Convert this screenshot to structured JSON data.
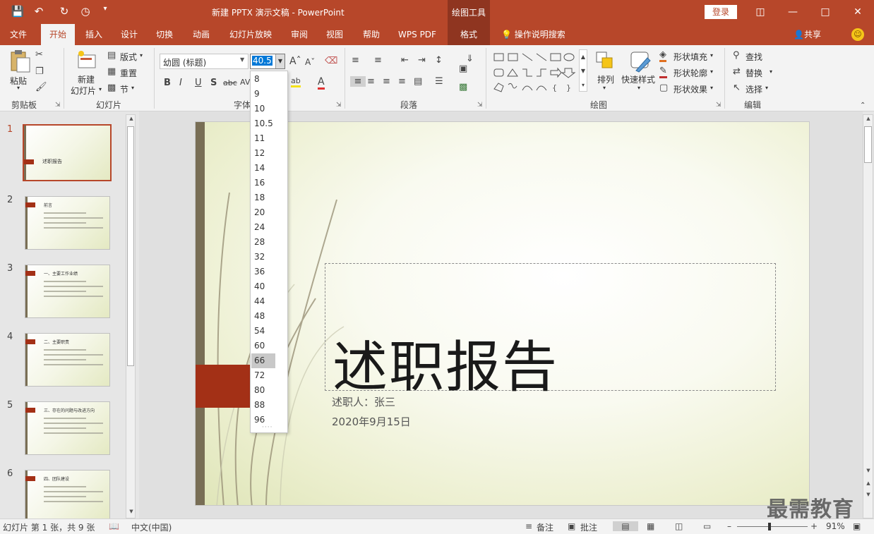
{
  "titlebar": {
    "doc_title": "新建 PPTX 演示文稿  -  PowerPoint",
    "context_tool": "绘图工具",
    "login": "登录"
  },
  "tabs": [
    "文件",
    "开始",
    "插入",
    "设计",
    "切换",
    "动画",
    "幻灯片放映",
    "审阅",
    "视图",
    "帮助",
    "WPS PDF",
    "格式"
  ],
  "active_tab": "开始",
  "tell_me": "操作说明搜索",
  "share": "共享",
  "ribbon": {
    "clipboard": {
      "paste": "粘贴",
      "label": "剪贴板"
    },
    "slides": {
      "new_slide_line1": "新建",
      "new_slide_line2": "幻灯片",
      "layout": "版式",
      "reset": "重置",
      "section": "节",
      "label": "幻灯片"
    },
    "font": {
      "font_name": "幼圆 (标题)",
      "font_size": "40.5",
      "label": "字体"
    },
    "paragraph": {
      "label": "段落"
    },
    "drawing": {
      "arrange": "排列",
      "quick_styles": "快速样式",
      "shape_fill": "形状填充",
      "shape_outline": "形状轮廓",
      "shape_effects": "形状效果",
      "label": "绘图"
    },
    "editing": {
      "find": "查找",
      "replace": "替换",
      "select": "选择",
      "label": "编辑"
    }
  },
  "font_sizes": [
    "8",
    "9",
    "10",
    "10.5",
    "11",
    "12",
    "14",
    "16",
    "18",
    "20",
    "24",
    "28",
    "32",
    "36",
    "40",
    "44",
    "48",
    "54",
    "60",
    "66",
    "72",
    "80",
    "88",
    "96"
  ],
  "highlighted_size": "66",
  "thumbnails": [
    {
      "num": "1",
      "title": "述职报告"
    },
    {
      "num": "2",
      "title": "前言"
    },
    {
      "num": "3",
      "title": "一、主要工作业绩"
    },
    {
      "num": "4",
      "title": "二、主要职责"
    },
    {
      "num": "5",
      "title": "三、存在的问题与改进方向"
    },
    {
      "num": "6",
      "title": "四、团队建设"
    }
  ],
  "slide": {
    "title": "述职报告",
    "presenter": "述职人：张三",
    "date": "2020年9月15日"
  },
  "status": {
    "slide_info": "幻灯片 第 1 张，共 9 张",
    "language": "中文(中国)",
    "notes": "备注",
    "comments": "批注",
    "zoom": "91%"
  },
  "watermark": "最需教育",
  "colors": {
    "accent": "#b7472a",
    "context": "#8f3520",
    "slide_tag": "#a33016"
  }
}
